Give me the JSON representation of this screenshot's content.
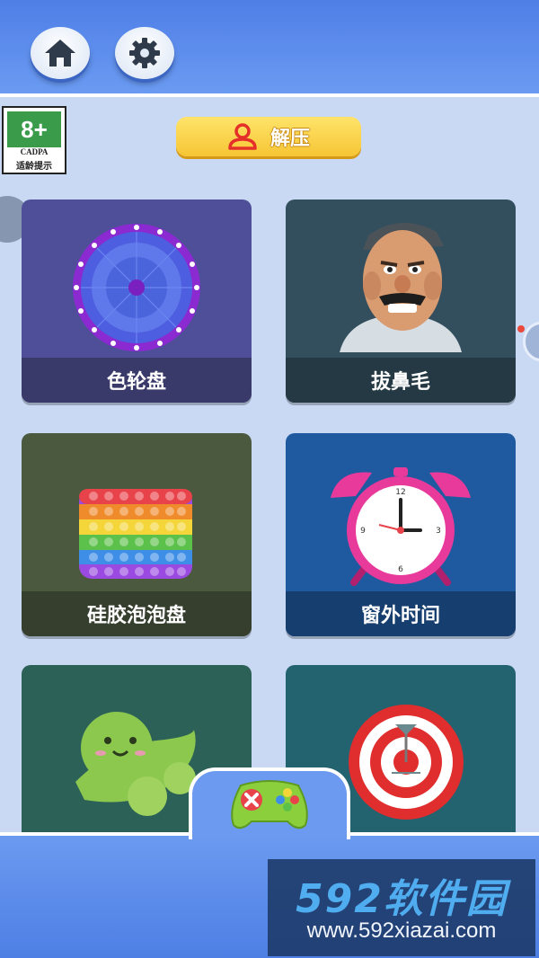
{
  "top_bar": {
    "home_icon": "home-icon",
    "settings_icon": "gear-icon"
  },
  "age_rating": {
    "rating": "8+",
    "org": "CADPA",
    "note": "适龄提示"
  },
  "category": {
    "label": "解压",
    "icon": "person-icon"
  },
  "games": [
    {
      "label": "色轮盘",
      "icon": "color-wheel-icon"
    },
    {
      "label": "拔鼻毛",
      "icon": "cartoon-face-icon"
    },
    {
      "label": "硅胶泡泡盘",
      "icon": "pop-it-icon"
    },
    {
      "label": "窗外时间",
      "icon": "alarm-clock-icon"
    },
    {
      "label": "",
      "icon": "pea-pod-icon"
    },
    {
      "label": "",
      "icon": "dartboard-icon"
    }
  ],
  "bottom_nav": {
    "icon": "gamepad-icon"
  },
  "watermark": {
    "brand": "592软件园",
    "url": "www.592xiazai.com"
  },
  "colors": {
    "accent": "#5a86e8",
    "pill": "#f6c534",
    "panel": "#c9d9f3"
  }
}
